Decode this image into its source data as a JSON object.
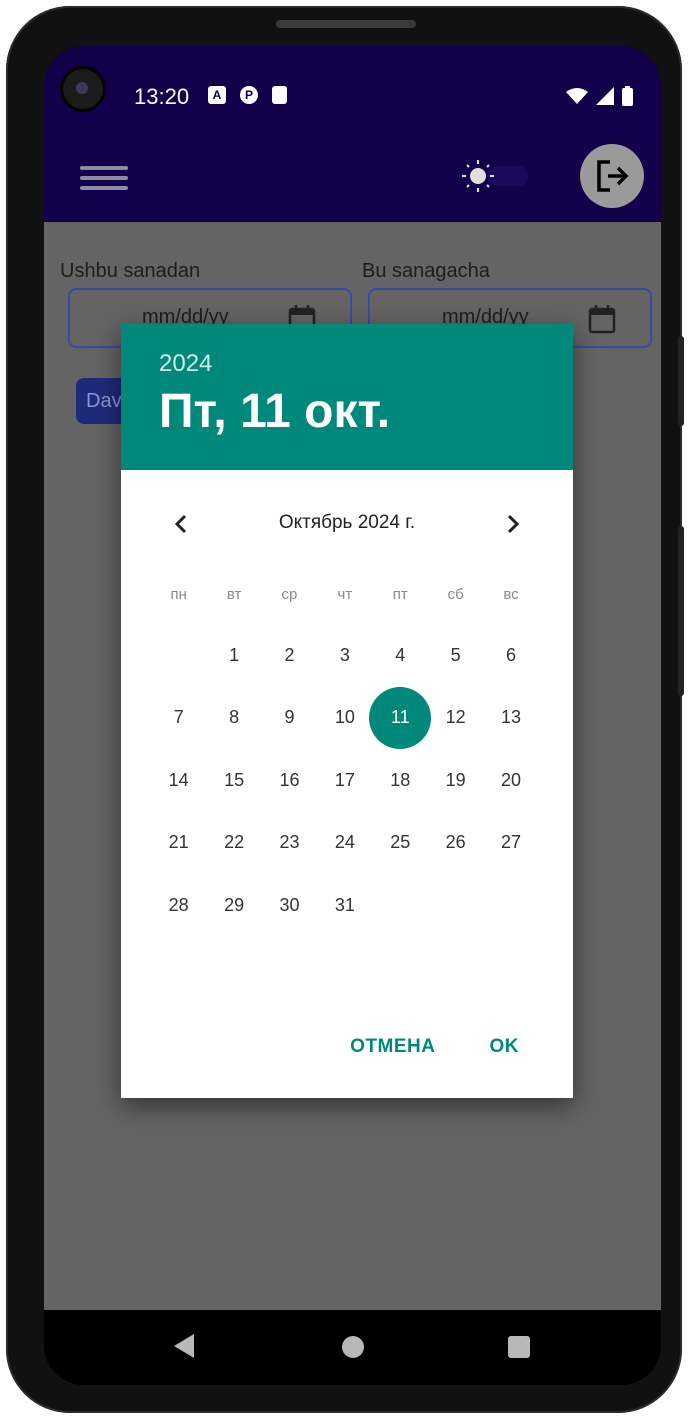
{
  "status_bar": {
    "time": "13:20",
    "icons": [
      "a-icon",
      "badge-icon",
      "sd-card-icon"
    ]
  },
  "header": {
    "menu_icon": "menu-icon",
    "theme_icon": "sun-icon",
    "logout_icon": "logout-icon"
  },
  "form": {
    "from_label": "Ushbu sanadan",
    "to_label": "Bu sanagacha",
    "from_placeholder": "mm/dd/yy",
    "to_placeholder": "mm/dd/yy",
    "button_partial": "Dav"
  },
  "date_picker": {
    "year": "2024",
    "selected_date": "Пт, 11 окт.",
    "month_label": "Октябрь 2024 г.",
    "weekdays": [
      "пн",
      "вт",
      "ср",
      "чт",
      "пт",
      "сб",
      "вс"
    ],
    "leading_blanks": 1,
    "days": [
      "1",
      "2",
      "3",
      "4",
      "5",
      "6",
      "7",
      "8",
      "9",
      "10",
      "11",
      "12",
      "13",
      "14",
      "15",
      "16",
      "17",
      "18",
      "19",
      "20",
      "21",
      "22",
      "23",
      "24",
      "25",
      "26",
      "27",
      "28",
      "29",
      "30",
      "31"
    ],
    "selected_day": "11",
    "cancel_label": "ОТМЕНА",
    "ok_label": "OK"
  },
  "colors": {
    "app_bar": "#12004a",
    "accent": "#00897b",
    "scrim": "#646464"
  }
}
